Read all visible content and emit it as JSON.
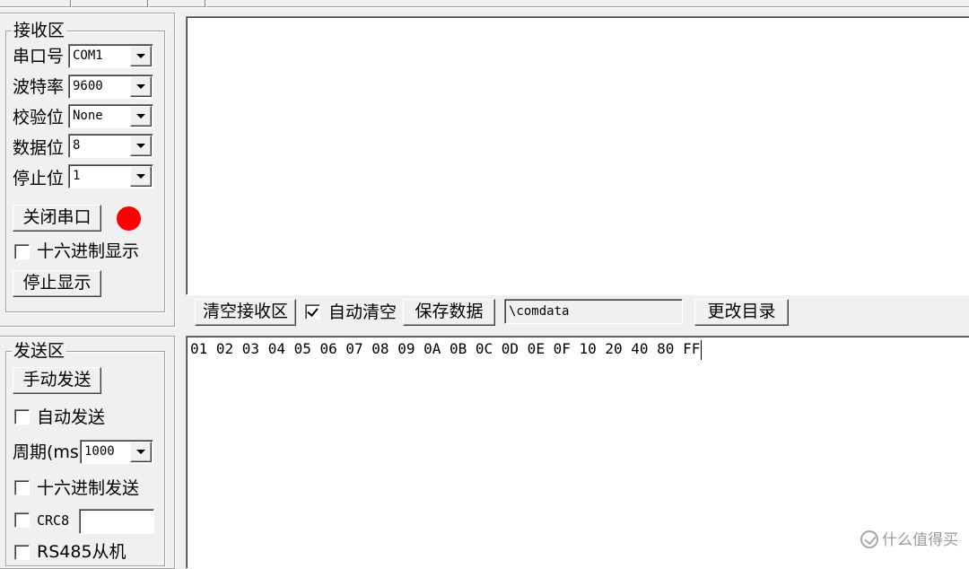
{
  "receive": {
    "title": "接收区",
    "port_label": "串口号",
    "port_value": "COM1",
    "baud_label": "波特率",
    "baud_value": "9600",
    "parity_label": "校验位",
    "parity_value": "None",
    "databits_label": "数据位",
    "databits_value": "8",
    "stopbits_label": "停止位",
    "stopbits_value": "1",
    "close_port_label": "关闭串口",
    "status_color": "#ff0000",
    "hex_display_label": "十六进制显示",
    "hex_display_checked": false,
    "stop_display_label": "停止显示"
  },
  "toolbar": {
    "clear_label": "清空接收区",
    "auto_clear_label": "自动清空",
    "auto_clear_checked": true,
    "save_label": "保存数据",
    "path_value": "\\comdata",
    "change_dir_label": "更改目录"
  },
  "send": {
    "title": "发送区",
    "manual_send_label": "手动发送",
    "auto_send_label": "自动发送",
    "auto_send_checked": false,
    "period_label": "周期(ms)",
    "period_value": "1000",
    "hex_send_label": "十六进制发送",
    "hex_send_checked": false,
    "crc8_label": "CRC8",
    "crc8_value": "",
    "rs485_label": "RS485从机",
    "text": "01 02 03 04 05 06 07 08 09 0A 0B 0C 0D 0E 0F 10 20 40 80 FF"
  },
  "watermark": {
    "text": "什么值得买"
  }
}
